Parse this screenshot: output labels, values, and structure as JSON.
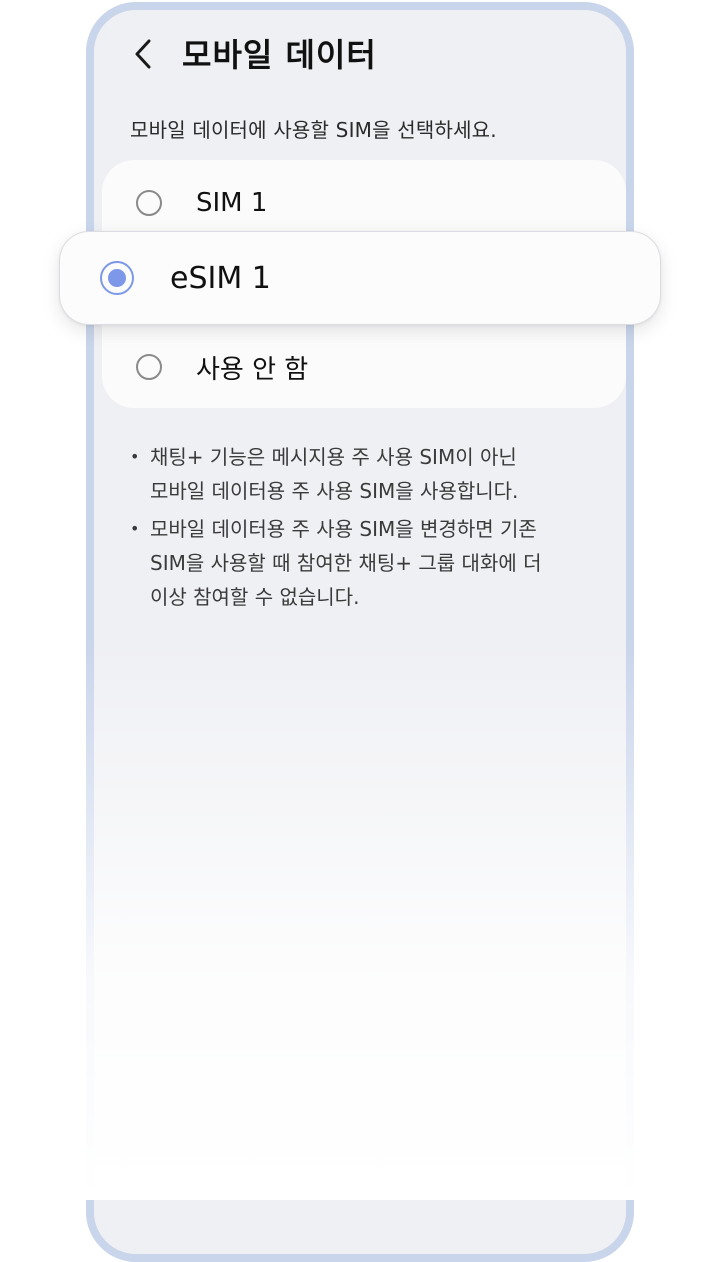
{
  "header": {
    "title": "모바일 데이터",
    "back_icon": "chevron-left-icon"
  },
  "description": "모바일 데이터에 사용할 SIM을 선택하세요.",
  "options": [
    {
      "label": "SIM 1",
      "selected": false
    },
    {
      "label": "eSIM 1",
      "selected": true
    },
    {
      "label": "사용 안 함",
      "selected": false
    }
  ],
  "notes": [
    {
      "bullet": "•",
      "text": "채팅+ 기능은 메시지용 주 사용 SIM이 아닌\n모바일 데이터용 주 사용 SIM을 사용합니다."
    },
    {
      "bullet": "•",
      "text": "모바일 데이터용 주 사용 SIM을 변경하면 기존\nSIM을 사용할 때 참여한 채팅+ 그룹 대화에 더\n이상 참여할 수 없습니다."
    }
  ],
  "colors": {
    "frame": "#c9d5eb",
    "screen_bg": "#eff0f4",
    "accent": "#7d98e8"
  }
}
